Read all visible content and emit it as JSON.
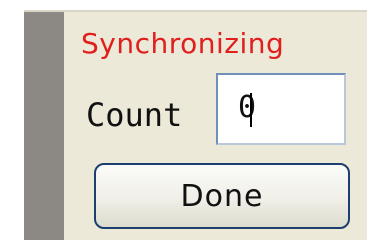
{
  "status": {
    "text": "Synchronizing",
    "color": "#e0201e"
  },
  "count": {
    "label": "Count",
    "value": "0"
  },
  "done_button": {
    "label": "Done"
  }
}
